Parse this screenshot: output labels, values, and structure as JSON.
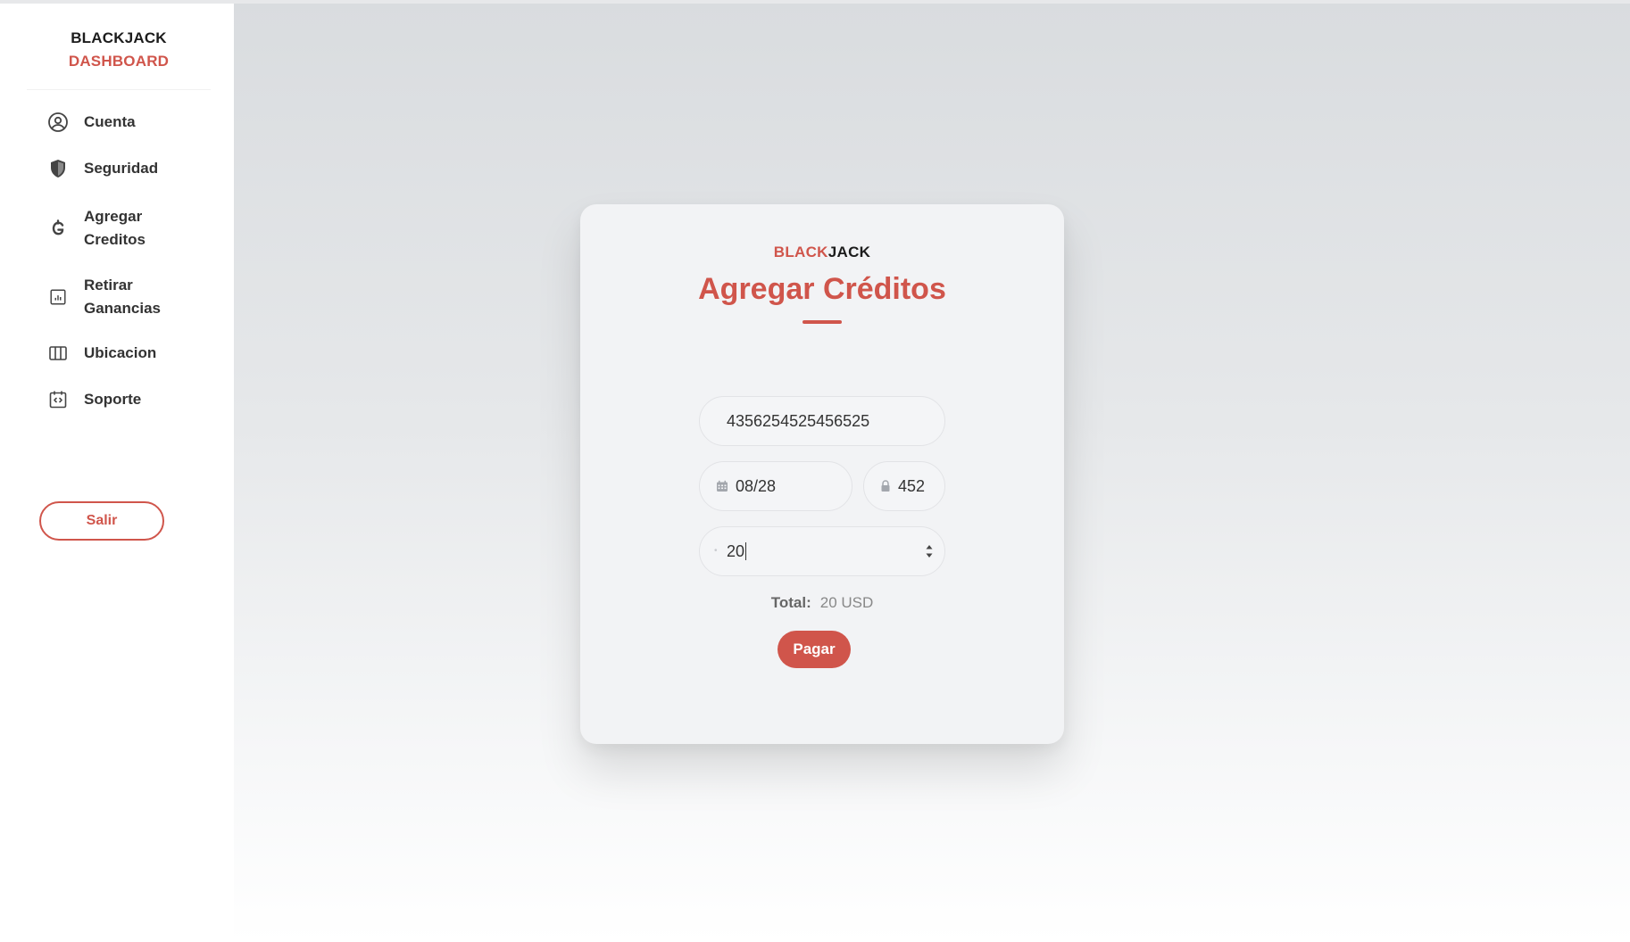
{
  "sidebar": {
    "brand_line1": "BLACKJACK",
    "brand_line2": "DASHBOARD",
    "items": [
      {
        "label": "Cuenta",
        "icon": "user-circle-icon"
      },
      {
        "label": "Seguridad",
        "icon": "shield-icon"
      },
      {
        "label_line1": "Agregar",
        "label_line2": "Creditos",
        "icon": "currency-icon"
      },
      {
        "label_line1": "Retirar",
        "label_line2": "Ganancias",
        "icon": "chart-icon"
      },
      {
        "label": "Ubicacion",
        "icon": "map-icon"
      },
      {
        "label": "Soporte",
        "icon": "code-support-icon"
      }
    ],
    "logout_label": "Salir"
  },
  "card": {
    "brand_red": "BLACK",
    "brand_dark": "JACK",
    "title": "Agregar Créditos",
    "card_number": "4356254525456525",
    "expiry": "08/28",
    "cvv": "452",
    "amount": "20",
    "total_label": "Total:",
    "total_value": "20 USD",
    "pay_label": "Pagar"
  },
  "colors": {
    "accent": "#d0554b",
    "card_bg": "#f2f3f5",
    "sidebar_bg": "#ffffff"
  }
}
